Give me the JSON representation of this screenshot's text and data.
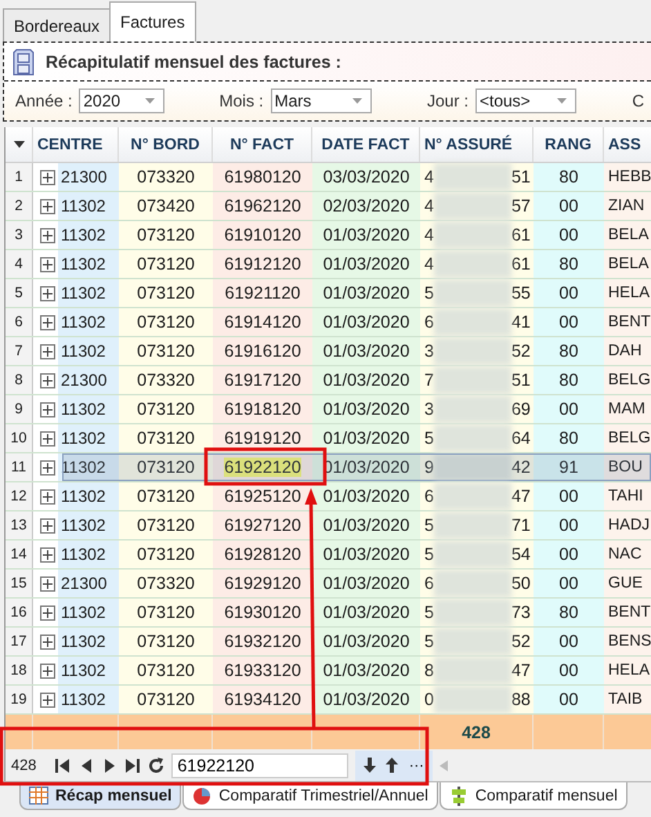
{
  "tabs": [
    {
      "label": "Bordereaux",
      "selected": false
    },
    {
      "label": "Factures",
      "selected": true
    }
  ],
  "panel": {
    "title": "Récapitulatif mensuel des factures :"
  },
  "filters": [
    {
      "label": "Année :",
      "value": "2020"
    },
    {
      "label": "Mois :",
      "value": "Mars"
    },
    {
      "label": "Jour :",
      "value": "<tous>"
    }
  ],
  "filters_cut_label": "C",
  "table": {
    "columns": [
      "CENTRE",
      "N° BORD",
      "N° FACT",
      "DATE FACT",
      "N° ASSURÉ",
      "RANG",
      "ASS"
    ],
    "rows": [
      {
        "num": "1",
        "expanded": false,
        "selected": false,
        "centre": "21300",
        "bord": "073320",
        "fact": "61980120",
        "date": "03/03/2020",
        "assure_start": "4",
        "assure_end": "51",
        "rang": "80",
        "assu": "HEBB"
      },
      {
        "num": "2",
        "expanded": false,
        "selected": false,
        "centre": "11302",
        "bord": "073420",
        "fact": "61962120",
        "date": "02/03/2020",
        "assure_start": "4",
        "assure_end": "57",
        "rang": "00",
        "assu": "ZIAN"
      },
      {
        "num": "3",
        "expanded": false,
        "selected": false,
        "centre": "11302",
        "bord": "073120",
        "fact": "61910120",
        "date": "01/03/2020",
        "assure_start": "4",
        "assure_end": "61",
        "rang": "00",
        "assu": "BELA"
      },
      {
        "num": "4",
        "expanded": false,
        "selected": false,
        "centre": "11302",
        "bord": "073120",
        "fact": "61912120",
        "date": "01/03/2020",
        "assure_start": "4",
        "assure_end": "61",
        "rang": "80",
        "assu": "BELA"
      },
      {
        "num": "5",
        "expanded": false,
        "selected": false,
        "centre": "11302",
        "bord": "073120",
        "fact": "61921120",
        "date": "01/03/2020",
        "assure_start": "5",
        "assure_end": "55",
        "rang": "00",
        "assu": "HELA"
      },
      {
        "num": "6",
        "expanded": false,
        "selected": false,
        "centre": "11302",
        "bord": "073120",
        "fact": "61914120",
        "date": "01/03/2020",
        "assure_start": "6",
        "assure_end": "41",
        "rang": "00",
        "assu": "BENT"
      },
      {
        "num": "7",
        "expanded": false,
        "selected": false,
        "centre": "11302",
        "bord": "073120",
        "fact": "61916120",
        "date": "01/03/2020",
        "assure_start": "3",
        "assure_end": "52",
        "rang": "80",
        "assu": "DAH"
      },
      {
        "num": "8",
        "expanded": false,
        "selected": false,
        "centre": "21300",
        "bord": "073320",
        "fact": "61917120",
        "date": "01/03/2020",
        "assure_start": "7",
        "assure_end": "51",
        "rang": "80",
        "assu": "BELG"
      },
      {
        "num": "9",
        "expanded": false,
        "selected": false,
        "centre": "11302",
        "bord": "073120",
        "fact": "61918120",
        "date": "01/03/2020",
        "assure_start": "3",
        "assure_end": "69",
        "rang": "00",
        "assu": "MAM"
      },
      {
        "num": "10",
        "expanded": false,
        "selected": false,
        "centre": "11302",
        "bord": "073120",
        "fact": "61919120",
        "date": "01/03/2020",
        "assure_start": "5",
        "assure_end": "64",
        "rang": "80",
        "assu": "BELG"
      },
      {
        "num": "11",
        "expanded": false,
        "selected": true,
        "centre": "11302",
        "bord": "073120",
        "fact": "61922120",
        "date": "01/03/2020",
        "assure_start": "9",
        "assure_end": "42",
        "rang": "91",
        "assu": "BOU"
      },
      {
        "num": "12",
        "expanded": false,
        "selected": false,
        "centre": "11302",
        "bord": "073120",
        "fact": "61925120",
        "date": "01/03/2020",
        "assure_start": "6",
        "assure_end": "47",
        "rang": "00",
        "assu": "TAHI"
      },
      {
        "num": "13",
        "expanded": false,
        "selected": false,
        "centre": "11302",
        "bord": "073120",
        "fact": "61927120",
        "date": "01/03/2020",
        "assure_start": "5",
        "assure_end": "71",
        "rang": "00",
        "assu": "HADJ"
      },
      {
        "num": "14",
        "expanded": false,
        "selected": false,
        "centre": "11302",
        "bord": "073120",
        "fact": "61928120",
        "date": "01/03/2020",
        "assure_start": "5",
        "assure_end": "54",
        "rang": "00",
        "assu": "NAC"
      },
      {
        "num": "15",
        "expanded": false,
        "selected": false,
        "centre": "21300",
        "bord": "073320",
        "fact": "61929120",
        "date": "01/03/2020",
        "assure_start": "6",
        "assure_end": "50",
        "rang": "00",
        "assu": "GUE"
      },
      {
        "num": "16",
        "expanded": false,
        "selected": false,
        "centre": "11302",
        "bord": "073120",
        "fact": "61930120",
        "date": "01/03/2020",
        "assure_start": "5",
        "assure_end": "73",
        "rang": "80",
        "assu": "BENT"
      },
      {
        "num": "17",
        "expanded": false,
        "selected": false,
        "centre": "11302",
        "bord": "073120",
        "fact": "61932120",
        "date": "01/03/2020",
        "assure_start": "5",
        "assure_end": "52",
        "rang": "00",
        "assu": "BENS"
      },
      {
        "num": "18",
        "expanded": false,
        "selected": false,
        "centre": "11302",
        "bord": "073120",
        "fact": "61933120",
        "date": "01/03/2020",
        "assure_start": "8",
        "assure_end": "47",
        "rang": "00",
        "assu": "HELA"
      },
      {
        "num": "19",
        "expanded": false,
        "selected": false,
        "centre": "11302",
        "bord": "073120",
        "fact": "61934120",
        "date": "01/03/2020",
        "assure_start": "0",
        "assure_end": "88",
        "rang": "00",
        "assu": "TAIB"
      }
    ],
    "footer_total": "428"
  },
  "navigator": {
    "count": "428",
    "search_value": "61922120",
    "more": "···"
  },
  "bottom_tabs": [
    {
      "label": "Récap mensuel",
      "kind": "grid",
      "selected": true
    },
    {
      "label": "Comparatif Trimestriel/Annuel",
      "kind": "pie",
      "selected": false
    },
    {
      "label": "Comparatif mensuel",
      "kind": "bars",
      "selected": false
    }
  ]
}
